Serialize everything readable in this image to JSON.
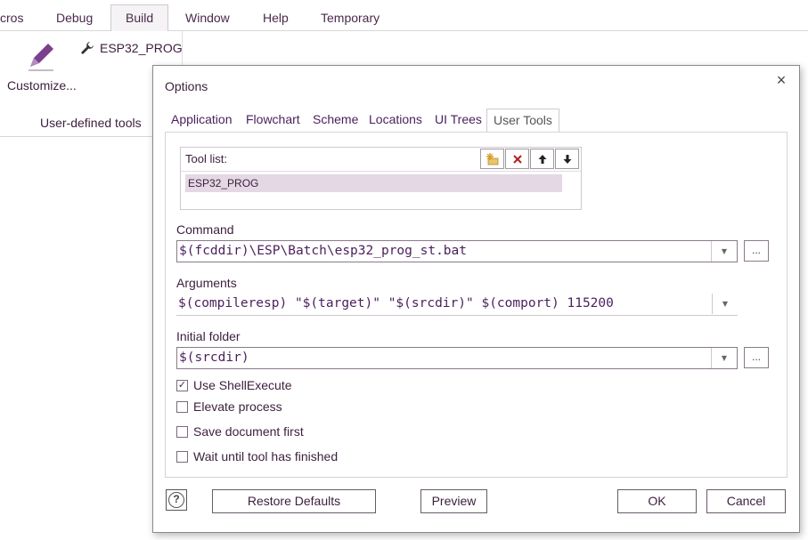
{
  "ribbon": {
    "tabs": [
      {
        "label": "cros"
      },
      {
        "label": "Debug"
      },
      {
        "label": "Build"
      },
      {
        "label": "Window"
      },
      {
        "label": "Help"
      },
      {
        "label": "Temporary"
      }
    ],
    "active_tab": "Build",
    "customize_label": "Customize...",
    "tool_button_label": "ESP32_PROG",
    "group_label": "User-defined tools",
    "icons": {
      "customize": "pencil-icon",
      "tool": "wrench-icon"
    }
  },
  "dialog": {
    "title": "Options",
    "close_glyph": "×",
    "tabs": [
      {
        "label": "Application"
      },
      {
        "label": "Flowchart"
      },
      {
        "label": "Scheme"
      },
      {
        "label": "Locations"
      },
      {
        "label": "UI Trees"
      },
      {
        "label": "User Tools"
      }
    ],
    "active_tab": "User Tools",
    "tool_list": {
      "label": "Tool list:",
      "items": [
        "ESP32_PROG"
      ],
      "selected": "ESP32_PROG",
      "buttons": {
        "add": "new-item-icon",
        "delete": "delete-icon",
        "up": "arrow-up-icon",
        "down": "arrow-down-icon"
      }
    },
    "command": {
      "label": "Command",
      "value": "$(fcddir)\\ESP\\Batch\\esp32_prog_st.bat",
      "browse_label": "..."
    },
    "arguments": {
      "label": "Arguments",
      "value": "$(compileresp) \"$(target)\" \"$(srcdir)\" $(comport) 115200"
    },
    "initial_folder": {
      "label": "Initial folder",
      "value": "$(srcdir)",
      "browse_label": "..."
    },
    "checkboxes": [
      {
        "label": "Use ShellExecute",
        "checked": true
      },
      {
        "label": "Elevate process",
        "checked": false
      },
      {
        "label": "Save document first",
        "checked": false
      },
      {
        "label": "Wait until tool has finished",
        "checked": false
      }
    ],
    "footer": {
      "help_glyph": "?",
      "restore_label": "Restore Defaults",
      "preview_label": "Preview",
      "ok_label": "OK",
      "cancel_label": "Cancel"
    }
  },
  "colors": {
    "accent": "#7b3f8c",
    "text": "#3c1e3c",
    "selection": "#e3d8e4"
  }
}
